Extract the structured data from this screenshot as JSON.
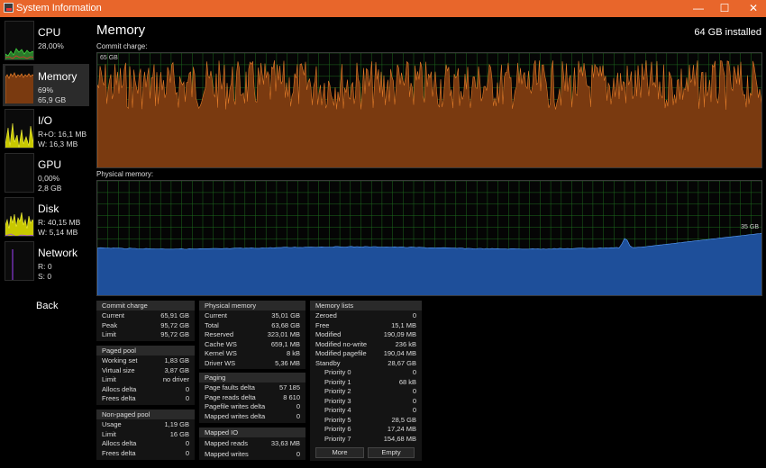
{
  "window": {
    "title": "System Information",
    "minimize_glyph": "—",
    "maximize_glyph": "☐",
    "close_glyph": "✕"
  },
  "sidebar": {
    "items": [
      {
        "name": "CPU",
        "line1": "28,00%",
        "line2": ""
      },
      {
        "name": "Memory",
        "line1": "69%",
        "line2": "65,9 GB"
      },
      {
        "name": "I/O",
        "line1": "R+O: 16,1 MB",
        "line2": "W: 16,3 MB"
      },
      {
        "name": "GPU",
        "line1": "0,00%",
        "line2": "2,8 GB"
      },
      {
        "name": "Disk",
        "line1": "R: 40,15 MB",
        "line2": "W: 5,14 MB"
      },
      {
        "name": "Network",
        "line1": "R: 0",
        "line2": "S: 0"
      }
    ],
    "back_label": "Back"
  },
  "main": {
    "title": "Memory",
    "installed": "64 GB installed",
    "commit_label": "Commit charge:",
    "commit_tag": "65 GB",
    "physical_label": "Physical memory:",
    "physical_tag": "35 GB"
  },
  "panels": {
    "commit": {
      "title": "Commit charge",
      "rows": [
        {
          "k": "Current",
          "v": "65,91 GB"
        },
        {
          "k": "Peak",
          "v": "95,72 GB"
        },
        {
          "k": "Limit",
          "v": "95,72 GB"
        }
      ]
    },
    "paged": {
      "title": "Paged pool",
      "rows": [
        {
          "k": "Working set",
          "v": "1,83 GB"
        },
        {
          "k": "Virtual size",
          "v": "3,87 GB"
        },
        {
          "k": "Limit",
          "v": "no driver"
        },
        {
          "k": "Allocs delta",
          "v": "0"
        },
        {
          "k": "Frees delta",
          "v": "0"
        }
      ]
    },
    "nonpaged": {
      "title": "Non-paged pool",
      "rows": [
        {
          "k": "Usage",
          "v": "1,19 GB"
        },
        {
          "k": "Limit",
          "v": "16 GB"
        },
        {
          "k": "Allocs delta",
          "v": "0"
        },
        {
          "k": "Frees delta",
          "v": "0"
        }
      ]
    },
    "physical": {
      "title": "Physical memory",
      "rows": [
        {
          "k": "Current",
          "v": "35,01 GB"
        },
        {
          "k": "Total",
          "v": "63,68 GB"
        },
        {
          "k": "Reserved",
          "v": "323,01 MB"
        },
        {
          "k": "Cache WS",
          "v": "659,1 MB"
        },
        {
          "k": "Kernel WS",
          "v": "8 kB"
        },
        {
          "k": "Driver WS",
          "v": "5,36 MB"
        }
      ]
    },
    "paging": {
      "title": "Paging",
      "rows": [
        {
          "k": "Page faults delta",
          "v": "57 185"
        },
        {
          "k": "Page reads delta",
          "v": "8 610"
        },
        {
          "k": "Pagefile writes delta",
          "v": "0"
        },
        {
          "k": "Mapped writes delta",
          "v": "0"
        }
      ]
    },
    "mappedio": {
      "title": "Mapped IO",
      "rows": [
        {
          "k": "Mapped reads",
          "v": "33,63 MB"
        },
        {
          "k": "Mapped writes",
          "v": "0"
        }
      ]
    },
    "lists": {
      "title": "Memory lists",
      "rows": [
        {
          "k": "Zeroed",
          "v": "0"
        },
        {
          "k": "Free",
          "v": "15,1 MB"
        },
        {
          "k": "Modified",
          "v": "190,09 MB"
        },
        {
          "k": "Modified no-write",
          "v": "236 kB"
        },
        {
          "k": "Modified pagefile",
          "v": "190,04 MB"
        },
        {
          "k": "Standby",
          "v": "28,67 GB"
        },
        {
          "k": "Priority 0",
          "v": "0"
        },
        {
          "k": "Priority 1",
          "v": "68 kB"
        },
        {
          "k": "Priority 2",
          "v": "0"
        },
        {
          "k": "Priority 3",
          "v": "0"
        },
        {
          "k": "Priority 4",
          "v": "0"
        },
        {
          "k": "Priority 5",
          "v": "28,5 GB"
        },
        {
          "k": "Priority 6",
          "v": "17,24 MB"
        },
        {
          "k": "Priority 7",
          "v": "154,68 MB"
        }
      ],
      "more_label": "More",
      "empty_label": "Empty"
    }
  },
  "colors": {
    "accent": "#e8662b",
    "commit_fill": "#7a3a10",
    "commit_line": "#e07a28",
    "physical_fill": "#1e4f9a",
    "physical_line": "#5aa0ff",
    "grid": "#1e6b1e"
  }
}
